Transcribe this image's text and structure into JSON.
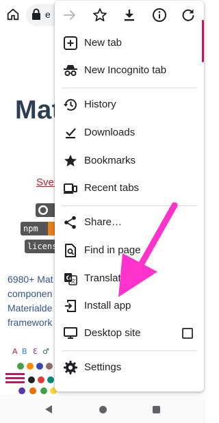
{
  "browser": {
    "url_partial": "e"
  },
  "page": {
    "title": "Mat",
    "link": "Svel",
    "badges": {
      "npm": "npm",
      "license": "license"
    },
    "description_lines": [
      "6980+ Mat",
      "componen",
      "Materialde",
      "framework"
    ]
  },
  "menu": {
    "toolbar": [
      "forward-icon",
      "bookmark-star-icon",
      "download-icon",
      "info-icon",
      "refresh-icon"
    ],
    "items": [
      {
        "label": "New tab",
        "icon": "new-tab-icon"
      },
      {
        "label": "New Incognito tab",
        "icon": "incognito-icon"
      },
      {
        "label": "History",
        "icon": "history-icon"
      },
      {
        "label": "Downloads",
        "icon": "downloads-icon"
      },
      {
        "label": "Bookmarks",
        "icon": "bookmarks-star-icon"
      },
      {
        "label": "Recent tabs",
        "icon": "recent-tabs-icon"
      },
      {
        "label": "Share…",
        "icon": "share-icon"
      },
      {
        "label": "Find in page",
        "icon": "find-in-page-icon"
      },
      {
        "label": "Translate…",
        "icon": "translate-icon"
      },
      {
        "label": "Install app",
        "icon": "install-app-icon"
      },
      {
        "label": "Desktop site",
        "icon": "desktop-site-icon",
        "checked": false
      },
      {
        "label": "Settings",
        "icon": "settings-icon"
      }
    ]
  },
  "annotation": {
    "arrow_color": "#ff33cc"
  },
  "colors": {
    "accent": "#c2185b",
    "page_title": "#2c3e55",
    "link": "#c21a2a",
    "description": "#34568b"
  }
}
